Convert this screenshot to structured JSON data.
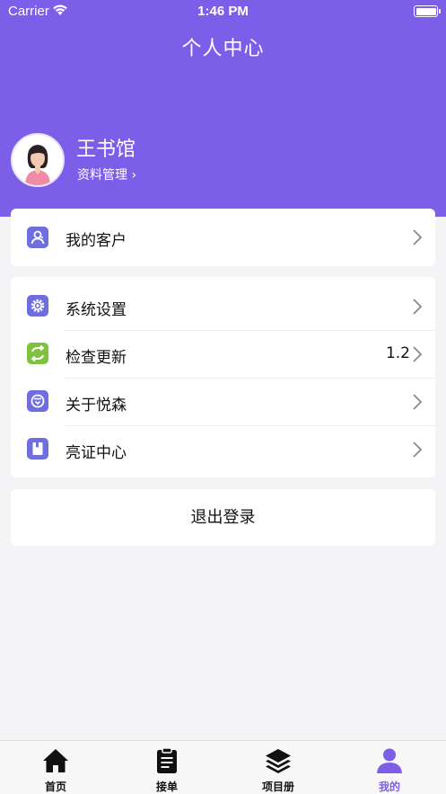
{
  "status_bar": {
    "carrier": "Carrier",
    "time": "1:46 PM"
  },
  "nav": {
    "title": "个人中心"
  },
  "profile": {
    "name": "王书馆",
    "link_label": "资料管理 ›"
  },
  "menu_group_1": [
    {
      "label": "我的客户",
      "icon": "customers-icon",
      "color": "#6f6ee0"
    }
  ],
  "menu_group_2": [
    {
      "label": "系统设置",
      "icon": "gear-icon",
      "color": "#6f6ee0"
    },
    {
      "label": "检查更新",
      "icon": "refresh-icon",
      "color": "#7ec23f",
      "value": "1.2"
    },
    {
      "label": "关于悦森",
      "icon": "about-icon",
      "color": "#6f6ee0"
    },
    {
      "label": "亮证中心",
      "icon": "bookmark-icon",
      "color": "#6f6ee0"
    }
  ],
  "logout_label": "退出登录",
  "tabbar": [
    {
      "label": "首页",
      "icon": "home-icon"
    },
    {
      "label": "接单",
      "icon": "clipboard-icon"
    },
    {
      "label": "项目册",
      "icon": "layers-icon"
    },
    {
      "label": "我的",
      "icon": "person-icon",
      "active": true
    }
  ],
  "colors": {
    "accent": "#7d5ee9",
    "background": "#f4f4f6",
    "update_icon": "#7ec23f",
    "menu_icon": "#6f6ee0"
  }
}
